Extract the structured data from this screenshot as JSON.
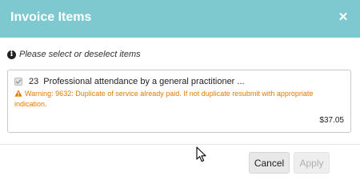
{
  "dialog": {
    "title": "Invoice Items",
    "close_icon": "close-icon"
  },
  "info": {
    "icon": "info-icon",
    "text": "Please select or deselect items"
  },
  "items": [
    {
      "checked": true,
      "code": "23",
      "description": "Professional attendance by a general practitioner ...",
      "warning": "Warning: 9632: Duplicate of service already paid. If not duplicate resubmit with appropriate indication.",
      "amount": "$37.05"
    }
  ],
  "footer": {
    "cancel_label": "Cancel",
    "apply_label": "Apply",
    "apply_disabled": true
  },
  "colors": {
    "header": "#7ec8cf",
    "warning": "#e07b00"
  }
}
